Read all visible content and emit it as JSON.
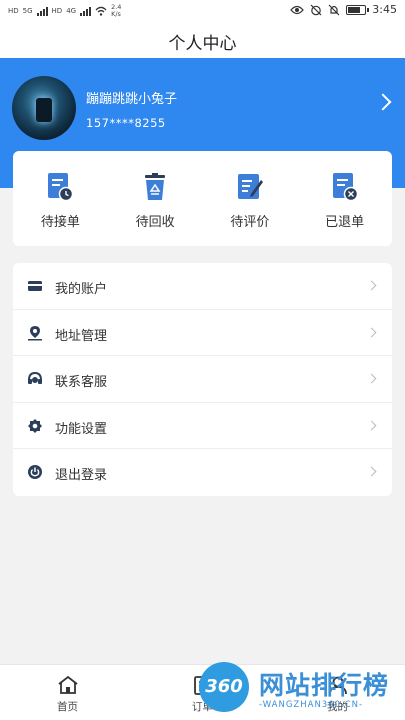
{
  "status_bar": {
    "carrier_hd1": "HD",
    "network1": "5G",
    "carrier_hd2": "HD",
    "network2": "4G",
    "speed_value": "2.4",
    "speed_unit": "K/s",
    "time": "3:45",
    "battery_level": 0.75
  },
  "title": "个人中心",
  "profile": {
    "username": "蹦蹦跳跳小兔子",
    "phone": "157****8255"
  },
  "orders": [
    {
      "label": "待接单",
      "icon": "pending-order-icon"
    },
    {
      "label": "待回收",
      "icon": "recycle-bin-icon"
    },
    {
      "label": "待评价",
      "icon": "review-edit-icon"
    },
    {
      "label": "已退单",
      "icon": "cancelled-order-icon"
    }
  ],
  "menu": [
    {
      "label": "我的账户",
      "icon": "card-icon"
    },
    {
      "label": "地址管理",
      "icon": "location-pin-icon"
    },
    {
      "label": "联系客服",
      "icon": "headset-icon"
    },
    {
      "label": "功能设置",
      "icon": "gear-icon"
    },
    {
      "label": "退出登录",
      "icon": "power-icon"
    }
  ],
  "tabs": [
    {
      "label": "首页",
      "icon": "home-icon"
    },
    {
      "label": "订单",
      "icon": "order-list-icon"
    },
    {
      "label": "我的",
      "icon": "user-icon"
    }
  ],
  "watermark": {
    "badge": "360",
    "text": "网站排行榜",
    "subtext": "-WANGZHAN360.CN-"
  },
  "colors": {
    "header_blue": "#2f87f0",
    "icon_blue": "#3d7fd8",
    "icon_dark": "#2c3e5a",
    "background": "#f2f2f2"
  }
}
